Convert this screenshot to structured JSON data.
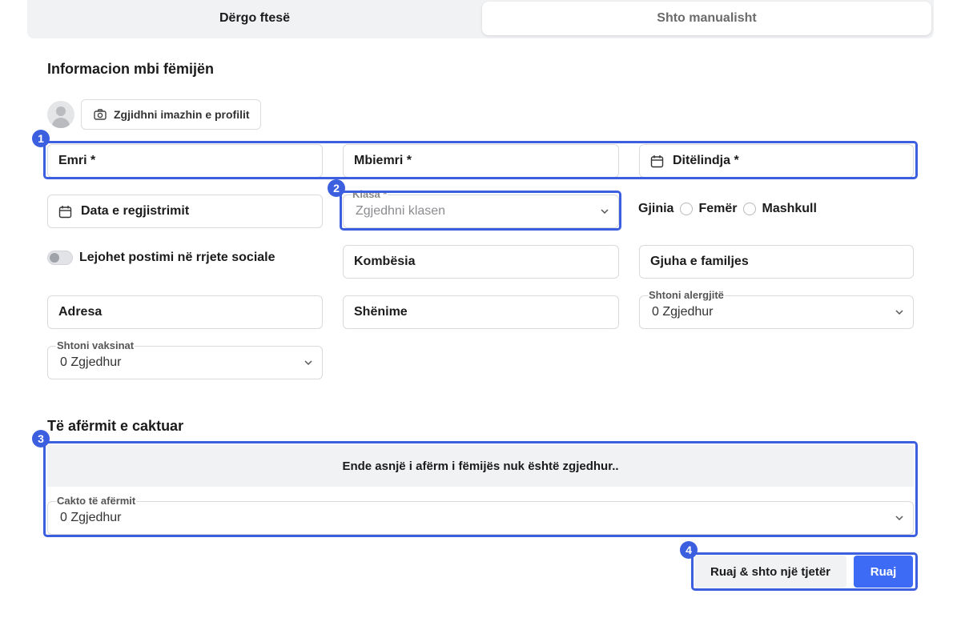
{
  "tabs": [
    {
      "label": "Dërgo ftesë"
    },
    {
      "label": "Shto manualisht"
    }
  ],
  "child_section": {
    "title": "Informacion mbi fëmijën",
    "profile_button": "Zgjidhni imazhin e profilit",
    "first_name": "Emri *",
    "last_name": "Mbiemri *",
    "birthdate": "Ditëlindja *",
    "registration_date": "Data e regjistrimit",
    "class": {
      "label": "Klasa *",
      "placeholder": "Zgjedhni klasen"
    },
    "gender": {
      "label": "Gjinia",
      "options": [
        "Femër",
        "Mashkull"
      ]
    },
    "social_toggle": "Lejohet postimi në rrjete sociale",
    "nationality": "Kombësia",
    "family_language": "Gjuha e familjes",
    "address": "Adresa",
    "notes": "Shënime",
    "allergies": {
      "label": "Shtoni alergjitë",
      "value": "0 Zgjedhur"
    },
    "vaccines": {
      "label": "Shtoni vaksinat",
      "value": "0 Zgjedhur"
    }
  },
  "relatives_section": {
    "title": "Të afërmit e caktuar",
    "empty_message": "Ende asnjë i afërm i fëmijës nuk është zgjedhur..",
    "assign": {
      "label": "Cakto të afërmit",
      "value": "0 Zgjedhur"
    }
  },
  "actions": {
    "save_and_add": "Ruaj & shto një tjetër",
    "save": "Ruaj"
  },
  "badges": [
    "1",
    "2",
    "3",
    "4"
  ],
  "colors": {
    "accent": "#3c5fe0",
    "primary_button": "#3d6bf5",
    "tab_bg": "#f1f2f4"
  }
}
